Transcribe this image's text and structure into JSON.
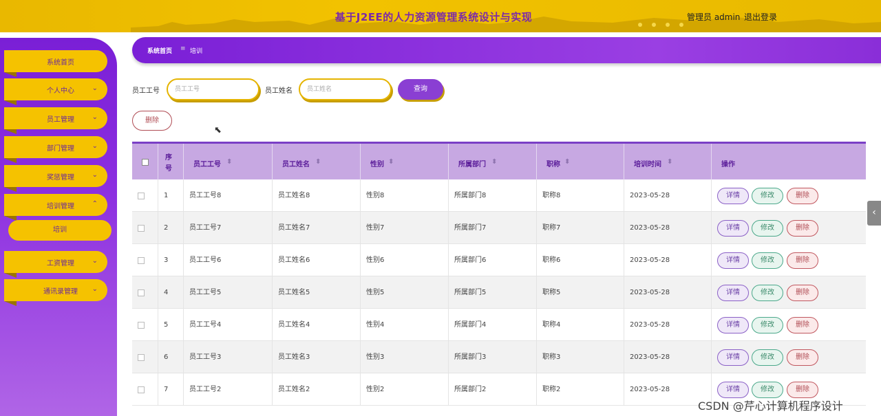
{
  "header": {
    "title": "基于J2EE的人力资源管理系统设计与实现",
    "user": "管理员 admin",
    "logout": "退出登录"
  },
  "sidebar": {
    "items": [
      {
        "label": "系统首页",
        "has_chevron": false
      },
      {
        "label": "个人中心",
        "has_chevron": true
      },
      {
        "label": "员工管理",
        "has_chevron": true
      },
      {
        "label": "部门管理",
        "has_chevron": true
      },
      {
        "label": "奖惩管理",
        "has_chevron": true
      },
      {
        "label": "培训管理",
        "has_chevron": true,
        "expanded": true
      },
      {
        "label": "工资管理",
        "has_chevron": true
      },
      {
        "label": "通讯录管理",
        "has_chevron": true
      }
    ],
    "sub_items": [
      {
        "label": "培训"
      }
    ]
  },
  "breadcrumb": {
    "home": "系统首页",
    "separator": "≡",
    "current": "培训"
  },
  "search": {
    "emp_id_label": "员工工号",
    "emp_id_placeholder": "员工工号",
    "emp_name_label": "员工姓名",
    "emp_name_placeholder": "员工姓名",
    "query_button": "查询"
  },
  "delete_button": "删除",
  "table": {
    "columns": [
      "序号",
      "员工工号",
      "员工姓名",
      "性别",
      "所属部门",
      "职称",
      "培训时间",
      "操作"
    ],
    "sort_icon": "⬍",
    "actions": {
      "detail": "详情",
      "edit": "修改",
      "delete": "删除"
    },
    "rows": [
      {
        "no": "1",
        "emp_id": "员工工号8",
        "name": "员工姓名8",
        "gender": "性别8",
        "dept": "所属部门8",
        "title": "职称8",
        "date": "2023-05-28"
      },
      {
        "no": "2",
        "emp_id": "员工工号7",
        "name": "员工姓名7",
        "gender": "性别7",
        "dept": "所属部门7",
        "title": "职称7",
        "date": "2023-05-28"
      },
      {
        "no": "3",
        "emp_id": "员工工号6",
        "name": "员工姓名6",
        "gender": "性别6",
        "dept": "所属部门6",
        "title": "职称6",
        "date": "2023-05-28"
      },
      {
        "no": "4",
        "emp_id": "员工工号5",
        "name": "员工姓名5",
        "gender": "性别5",
        "dept": "所属部门5",
        "title": "职称5",
        "date": "2023-05-28"
      },
      {
        "no": "5",
        "emp_id": "员工工号4",
        "name": "员工姓名4",
        "gender": "性别4",
        "dept": "所属部门4",
        "title": "职称4",
        "date": "2023-05-28"
      },
      {
        "no": "6",
        "emp_id": "员工工号3",
        "name": "员工姓名3",
        "gender": "性别3",
        "dept": "所属部门3",
        "title": "职称3",
        "date": "2023-05-28"
      },
      {
        "no": "7",
        "emp_id": "员工工号2",
        "name": "员工姓名2",
        "gender": "性别2",
        "dept": "所属部门2",
        "title": "职称2",
        "date": "2023-05-28"
      }
    ]
  },
  "watermark": "CSDN @芹心计算机程序设计",
  "colors": {
    "brand_yellow": "#f5c200",
    "brand_purple": "#8a2ed8",
    "header_purple": "#c7a8e2"
  }
}
